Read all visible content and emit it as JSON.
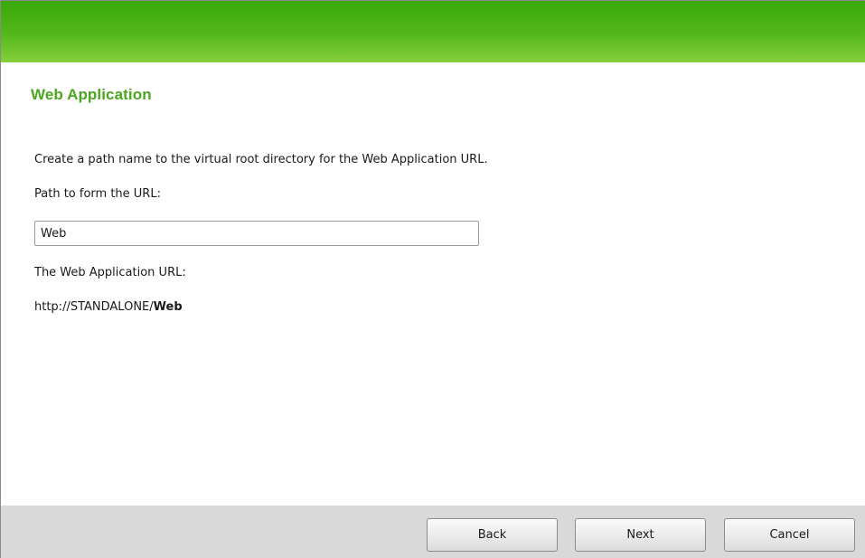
{
  "header": {
    "title": "Web Application"
  },
  "main": {
    "description": "Create a path name to the virtual root directory for the Web Application URL.",
    "path_label": "Path to form the URL:",
    "path_value": "Web",
    "url_label": "The Web Application URL:",
    "url_prefix": "http://STANDALONE/",
    "url_suffix": "Web"
  },
  "footer": {
    "back_label": "Back",
    "next_label": "Next",
    "cancel_label": "Cancel"
  },
  "colors": {
    "banner_green": "#55b81a",
    "title_green": "#4aa81e",
    "footer_gray": "#d9d9d9"
  }
}
